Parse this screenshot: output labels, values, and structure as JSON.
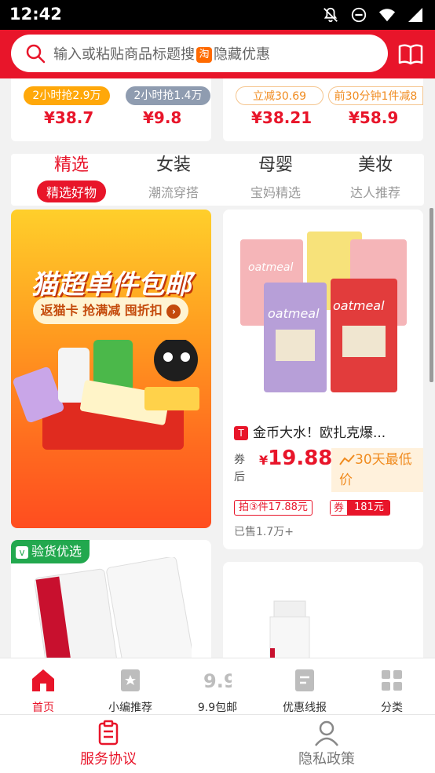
{
  "status_bar": {
    "time": "12:42"
  },
  "search": {
    "placeholder_prefix": "输入或粘贴商品标题搜",
    "tao_icon": "淘",
    "placeholder_suffix": "隐藏优惠"
  },
  "top_cards": {
    "left": {
      "tag1": "2小时抢2.9万",
      "tag2": "2小时抢1.4万",
      "price1": "¥38.7",
      "price2": "¥9.8"
    },
    "right": {
      "tag1": "立减30.69",
      "tag2": "前30分钟1件减8",
      "price1": "¥38.21",
      "price2": "¥58.9"
    }
  },
  "categories": [
    {
      "title": "精选",
      "sub": "精选好物",
      "active": true
    },
    {
      "title": "女装",
      "sub": "潮流穿搭",
      "active": false
    },
    {
      "title": "母婴",
      "sub": "宝妈精选",
      "active": false
    },
    {
      "title": "美妆",
      "sub": "达人推荐",
      "active": false
    }
  ],
  "promo": {
    "title": "猫超单件包邮",
    "subtitle": "返猫卡 抢满减 囤折扣"
  },
  "product": {
    "platform_icon": "T",
    "title": "金币大水！欧扎克爆...",
    "quan_label_1": "券",
    "quan_label_2": "后",
    "currency": "¥",
    "price": "19.88",
    "lowest_line1": "30天最低",
    "lowest_line2": "价",
    "deal": "拍③件17.88元",
    "coupon_label": "券",
    "coupon_value": "181元",
    "sold": "已售1.7万+",
    "pack_text": "oatmeal"
  },
  "verify_badge": "验货优选",
  "bottom_nav": [
    {
      "label": "首页",
      "icon": "home-icon",
      "active": true
    },
    {
      "label": "小编推荐",
      "icon": "recommend-icon",
      "active": false
    },
    {
      "label": "9.9包邮",
      "icon": "nine-nine-icon",
      "active": false
    },
    {
      "label": "优惠线报",
      "icon": "deals-icon",
      "active": false
    },
    {
      "label": "分类",
      "icon": "category-icon",
      "active": false
    }
  ],
  "policy": [
    {
      "label": "服务协议",
      "active": true
    },
    {
      "label": "隐私政策",
      "active": false
    }
  ],
  "colors": {
    "brand": "#e8152a",
    "accent_orange": "#f08b1f",
    "verify_green": "#22a84e"
  }
}
